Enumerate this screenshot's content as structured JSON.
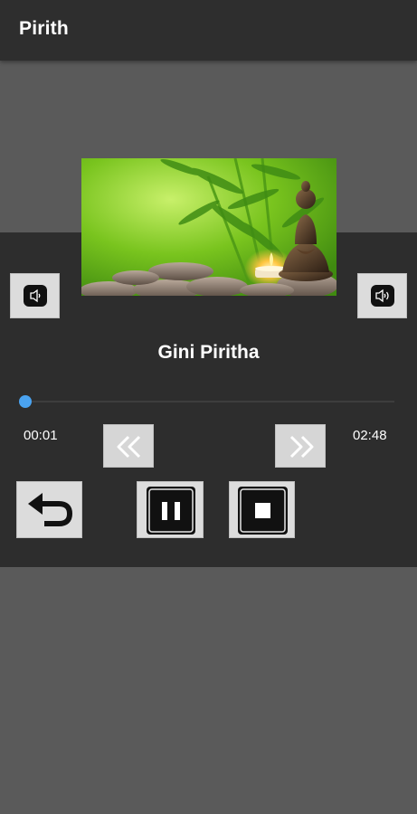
{
  "app": {
    "title": "Pirith"
  },
  "artwork": {
    "icon": "buddha-statue-candle-image"
  },
  "player": {
    "track_title": "Gini Piritha",
    "current_time": "00:01",
    "total_time": "02:48",
    "progress_fraction": 0.006
  },
  "controls": {
    "volume_down_icon": "volume-down-icon",
    "volume_up_icon": "volume-up-icon",
    "rewind_icon": "double-chevron-left-icon",
    "forward_icon": "double-chevron-right-icon",
    "back_icon": "undo-arrow-icon",
    "pause_icon": "pause-icon",
    "stop_icon": "stop-icon"
  },
  "colors": {
    "app_bar": "#2e2e2e",
    "background": "#5a5a5a",
    "panel": "#2d2d2d",
    "seek_accent": "#4aa3f0",
    "button_face": "#dcdcdc"
  }
}
